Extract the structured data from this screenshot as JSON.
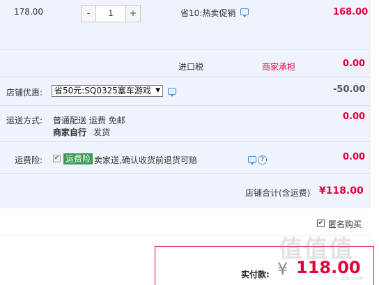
{
  "item": {
    "unit_price": "178.00",
    "qty_minus": "-",
    "quantity": "1",
    "qty_plus": "+",
    "promo_text": "省10:热卖促销",
    "subtotal": "168.00"
  },
  "import_tax": {
    "label": "进口税",
    "bearer": "商家承担",
    "amount": "0.00"
  },
  "store_discount": {
    "label": "店铺优惠:",
    "selected": "省50元:SQ0325塞车游戏",
    "amount": "-50.00"
  },
  "shipping": {
    "label": "运送方式:",
    "method": "普通配送 运费 免邮",
    "carrier": "商家自行",
    "carrier_suffix": "发货",
    "amount": "0.00"
  },
  "insurance": {
    "label": "运费险:",
    "tag": "运费险",
    "desc": "卖家送,确认收货前退货可赔",
    "amount": "0.00"
  },
  "store_total": {
    "label": "店铺合计(含运费)",
    "amount": "¥118.00"
  },
  "anonymous": {
    "label": "匿名购买"
  },
  "payment": {
    "label": "实付款:",
    "currency": "¥",
    "amount": "118.00"
  },
  "watermark": {
    "text": "值值值",
    "site": "zhi.com"
  },
  "colors": {
    "accent_red": "#e4003a",
    "panel_bg": "#eef3fc",
    "green_tag": "#3a9b52",
    "icon_blue": "#4a90d9"
  }
}
